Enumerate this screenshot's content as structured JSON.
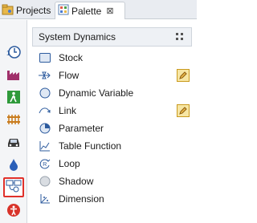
{
  "tabs": [
    {
      "label": "Projects"
    },
    {
      "label": "Palette",
      "close": "⊠"
    }
  ],
  "panel": {
    "title": "System Dynamics"
  },
  "items": [
    {
      "label": "Stock",
      "icon": "stock-icon"
    },
    {
      "label": "Flow",
      "icon": "flow-icon",
      "editable": true
    },
    {
      "label": "Dynamic Variable",
      "icon": "dynamic-variable-icon"
    },
    {
      "label": "Link",
      "icon": "link-icon",
      "editable": true
    },
    {
      "label": "Parameter",
      "icon": "parameter-icon"
    },
    {
      "label": "Table Function",
      "icon": "table-function-icon"
    },
    {
      "label": "Loop",
      "icon": "loop-icon"
    },
    {
      "label": "Shadow",
      "icon": "shadow-icon"
    },
    {
      "label": "Dimension",
      "icon": "dimension-icon"
    }
  ],
  "sidebar": [
    {
      "icon": "clock-icon"
    },
    {
      "icon": "factory-icon"
    },
    {
      "icon": "pedestrian-icon"
    },
    {
      "icon": "rail-icon"
    },
    {
      "icon": "car-icon"
    },
    {
      "icon": "fluid-drop-icon"
    },
    {
      "icon": "system-dynamics-icon",
      "active": true
    },
    {
      "icon": "accessibility-icon"
    }
  ],
  "colors": {
    "accent": "#e0302a",
    "tab_bg": "#e9ecf1",
    "panel_bg": "#eef1f5"
  }
}
